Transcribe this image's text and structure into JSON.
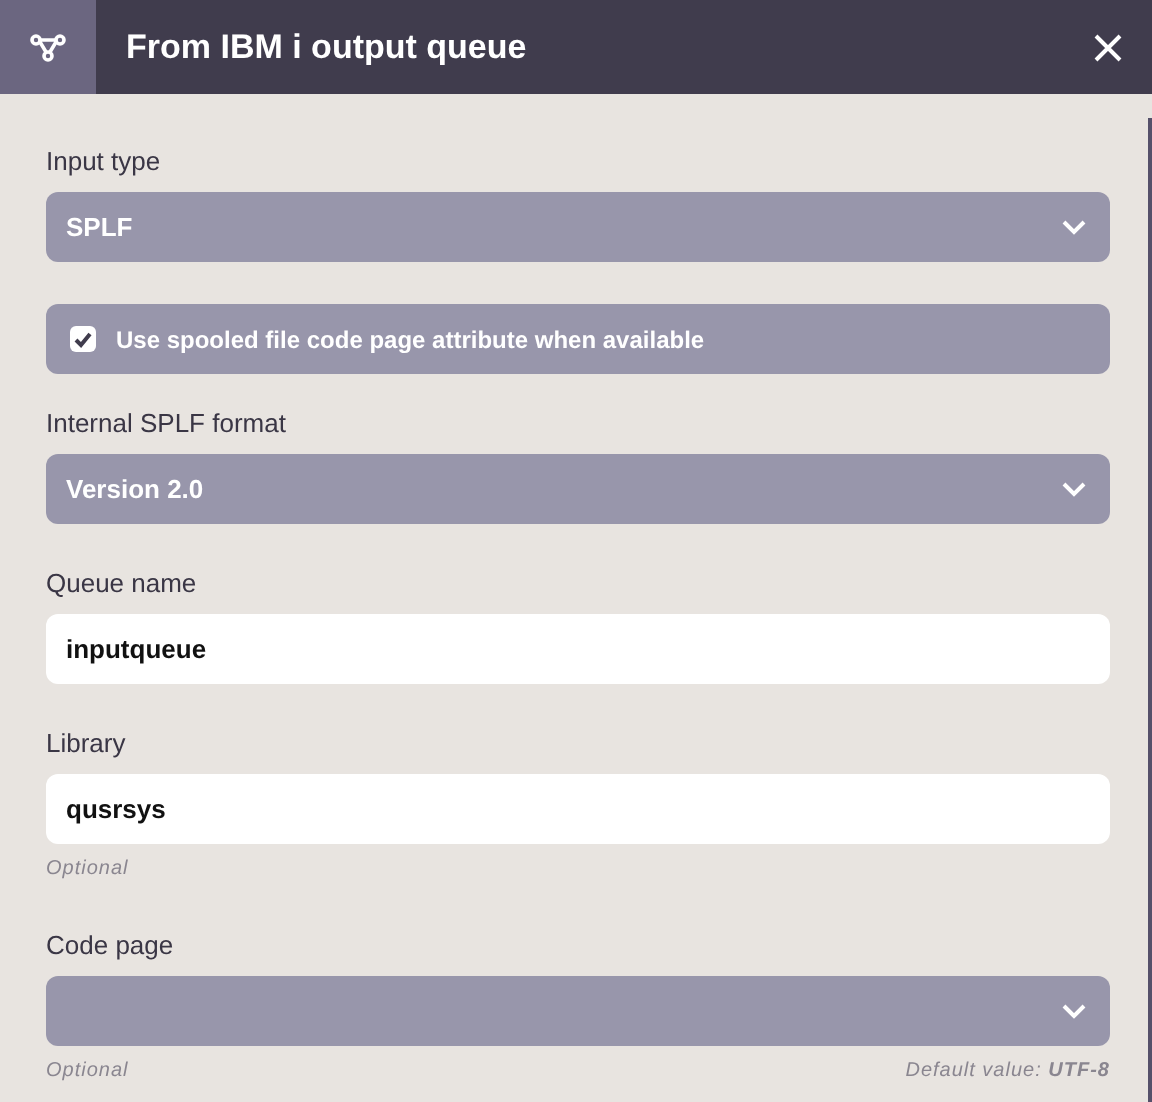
{
  "window": {
    "title": "From IBM i output queue"
  },
  "fields": [
    {
      "kind": "select",
      "label": "Input type",
      "value": "SPLF"
    },
    {
      "kind": "checkbox",
      "label": "Use spooled file code page attribute when available",
      "checked": true
    },
    {
      "kind": "select",
      "label": "Internal SPLF format",
      "value": "Version 2.0"
    },
    {
      "kind": "input",
      "label": "Queue name",
      "value": "inputqueue"
    },
    {
      "kind": "input",
      "label": "Library",
      "value": "qusrsys",
      "hint": "Optional"
    },
    {
      "kind": "select",
      "label": "Code page",
      "hint": "Optional",
      "default_note": "Default value: **UTF-8**"
    }
  ]
}
